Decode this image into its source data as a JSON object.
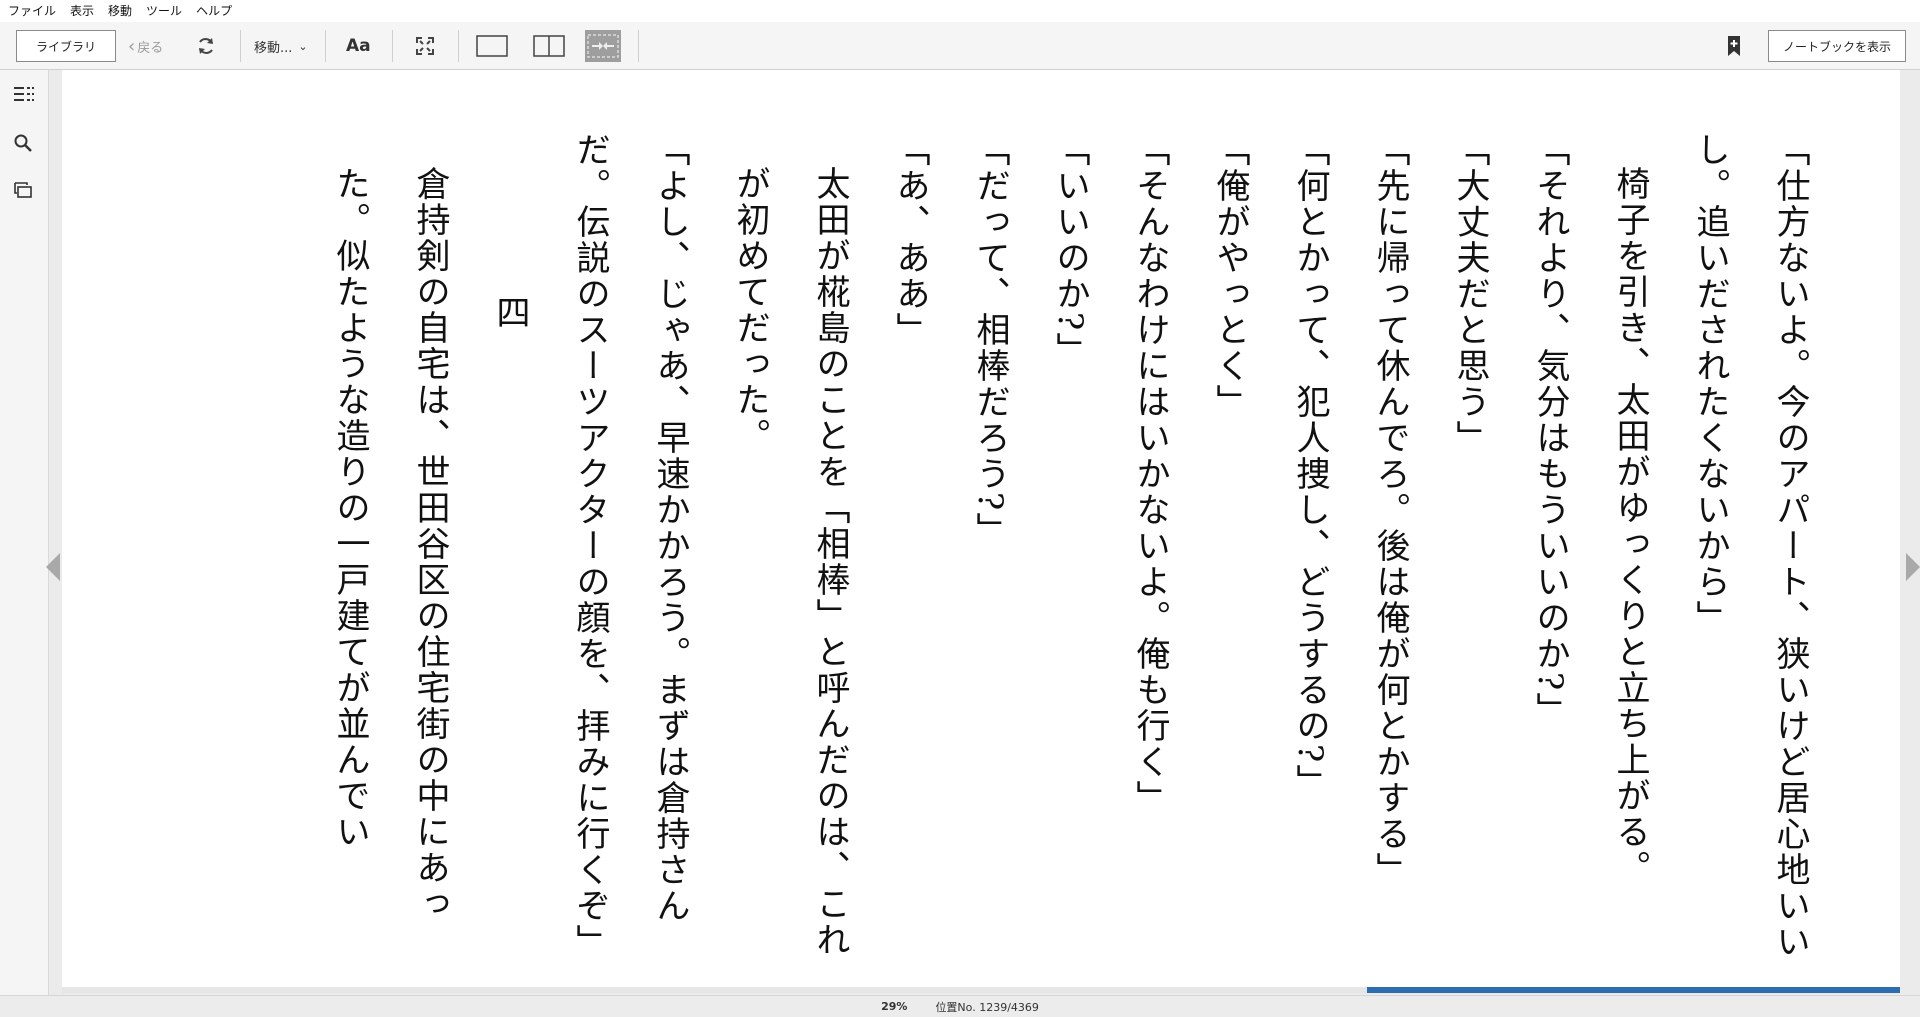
{
  "menu": {
    "items": [
      "ファイル",
      "表示",
      "移動",
      "ツール",
      "ヘルプ"
    ]
  },
  "toolbar": {
    "library_label": "ライブラリ",
    "back_label": "戻る",
    "goto_label": "移動...",
    "font_label": "Aa",
    "notebook_label": "ノートブックを表示"
  },
  "reader": {
    "paragraphs": [
      {
        "text": "「仕方ないよ。今のアパート、狭いけど居心地いいし。追いだされたくないから」",
        "style": "normal"
      },
      {
        "text": "椅子を引き、太田がゆっくりと立ち上がる。",
        "style": "indent"
      },
      {
        "text": "「それより、気分はもういいのか?」",
        "style": "normal"
      },
      {
        "text": "「大丈夫だと思う」",
        "style": "normal"
      },
      {
        "text": "「先に帰って休んでろ。後は俺が何とかする」",
        "style": "normal"
      },
      {
        "text": "「何とかって、犯人捜し、どうするの?」",
        "style": "normal"
      },
      {
        "text": "「俺がやっとく」",
        "style": "normal"
      },
      {
        "text": "「そんなわけにはいかないよ。俺も行く」",
        "style": "normal"
      },
      {
        "text": "「いいのか?」",
        "style": "normal"
      },
      {
        "text": "「だって、相棒だろう?」",
        "style": "normal"
      },
      {
        "text": "「あ、ああ」",
        "style": "normal"
      },
      {
        "text": "太田が椛島のことを「相棒」と呼んだのは、これが初めてだった。",
        "style": "indent"
      },
      {
        "text": "「よし、じゃあ、早速かかろう。まずは倉持さんだ。伝説のスーツアクターの顔を、拝みに行くぞ」",
        "style": "normal"
      },
      {
        "text": "四",
        "style": "chapter"
      },
      {
        "text": "倉持剣の自宅は、世田谷区の住宅街の中にあった。似たような造りの一戸建てが並んでい",
        "style": "indent"
      }
    ]
  },
  "status": {
    "percent": "29%",
    "location": "位置No. 1239/4369",
    "progress_fraction": 0.29
  },
  "colors": {
    "accent": "#2c6cb0",
    "page_bg": "#ffffff",
    "chrome_bg": "#f5f5f5"
  },
  "icons": {
    "toc": "toc-icon",
    "search": "search-icon",
    "flashcards": "flashcards-icon",
    "refresh": "sync-icon",
    "fullscreen": "fullscreen-icon",
    "single_column": "single-column-icon",
    "two_column": "two-column-icon",
    "fit_width": "fit-width-icon",
    "bookmark": "bookmark-add-icon"
  }
}
